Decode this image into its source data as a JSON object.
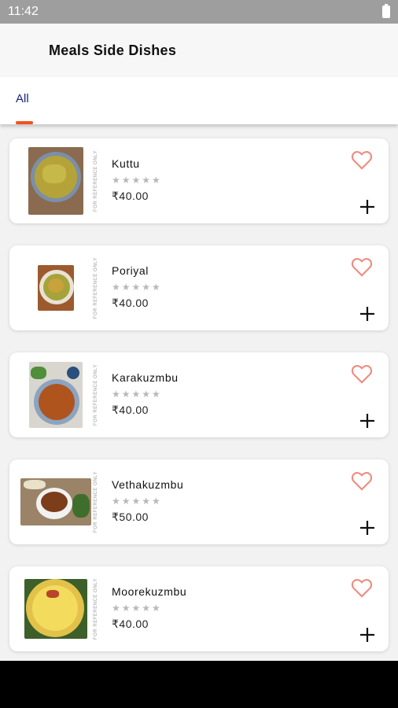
{
  "status_bar": {
    "time": "11:42"
  },
  "header": {
    "title": "Meals Side Dishes"
  },
  "tabs": [
    {
      "label": "All",
      "active": true
    }
  ],
  "reference_text": "FOR REFERENCE ONLY",
  "items": [
    {
      "name": "Kuttu",
      "rating_stars": "★★★★★",
      "price": "₹40.00",
      "favorite_icon": "heart-outline-icon",
      "add_icon": "plus-icon"
    },
    {
      "name": "Poriyal",
      "rating_stars": "★★★★★",
      "price": "₹40.00",
      "favorite_icon": "heart-outline-icon",
      "add_icon": "plus-icon"
    },
    {
      "name": "Karakuzmbu",
      "rating_stars": "★★★★★",
      "price": "₹40.00",
      "favorite_icon": "heart-outline-icon",
      "add_icon": "plus-icon"
    },
    {
      "name": "Vethakuzmbu",
      "rating_stars": "★★★★★",
      "price": "₹50.00",
      "favorite_icon": "heart-outline-icon",
      "add_icon": "plus-icon"
    },
    {
      "name": "Moorekuzmbu",
      "rating_stars": "★★★★★",
      "price": "₹40.00",
      "favorite_icon": "heart-outline-icon",
      "add_icon": "plus-icon"
    }
  ],
  "colors": {
    "accent": "#f4511e",
    "tab_text": "#1a237e",
    "heart": "#f08a7e",
    "star_empty": "#b8b8b8"
  }
}
